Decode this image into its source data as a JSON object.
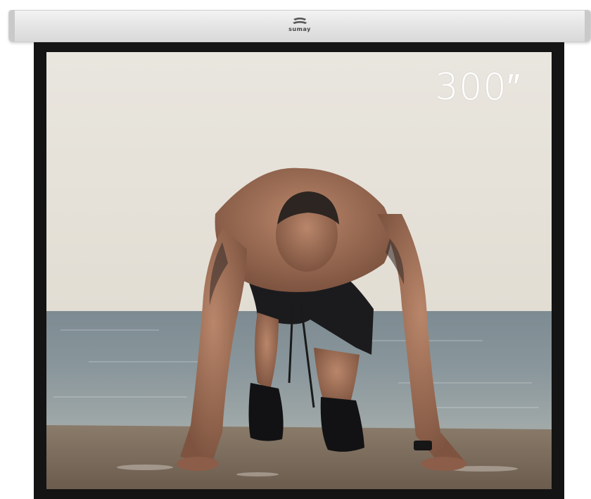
{
  "brand": {
    "name": "sumay"
  },
  "screen": {
    "size_label": "300″"
  },
  "colors": {
    "sky": "#e8e4dc",
    "sea": "#6f8088",
    "ground": "#7a6c5d",
    "frame": "#141414",
    "housing": "#e4e4e4"
  }
}
